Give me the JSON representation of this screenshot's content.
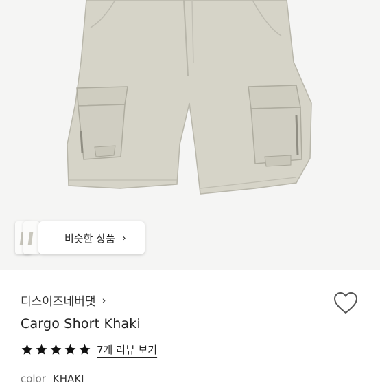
{
  "product": {
    "brand": "디스이즈네버댓",
    "title": "Cargo Short Khaki",
    "review_link": "7개 리뷰 보기",
    "rating_stars": 5,
    "color_label": "color",
    "color_value": "KHAKI"
  },
  "similar": {
    "label": "비슷한 상품"
  },
  "icons": {
    "chevron": "›",
    "star_color": "#111111",
    "heart": "heart-outline-icon"
  },
  "colors": {
    "image_background": "#f5f5f4",
    "shorts_fabric": "#d6d4c8"
  }
}
